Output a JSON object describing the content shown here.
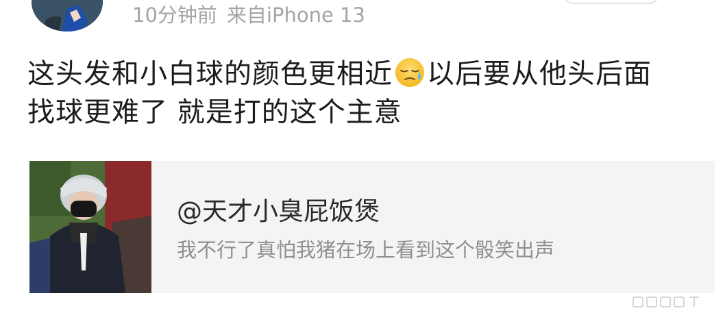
{
  "post": {
    "time": "10分钟前",
    "source": "来自iPhone 13",
    "text_line1_a": "这头发和小白球的颜色更相近",
    "emoji": "cold-sweat-face-emoji",
    "text_line1_b": "以后要从他头后面",
    "text_line2": "找球更难了 就是打的这个主意"
  },
  "quoted": {
    "author": "@天才小臭屁饭煲",
    "text": "我不行了真怕我猪在场上看到这个骰笑出声"
  },
  "colors": {
    "meta_text": "#a4a4a4",
    "body_text": "#1c1c1c",
    "card_bg": "#f4f4f4",
    "quote_text": "#8f8f8f"
  }
}
